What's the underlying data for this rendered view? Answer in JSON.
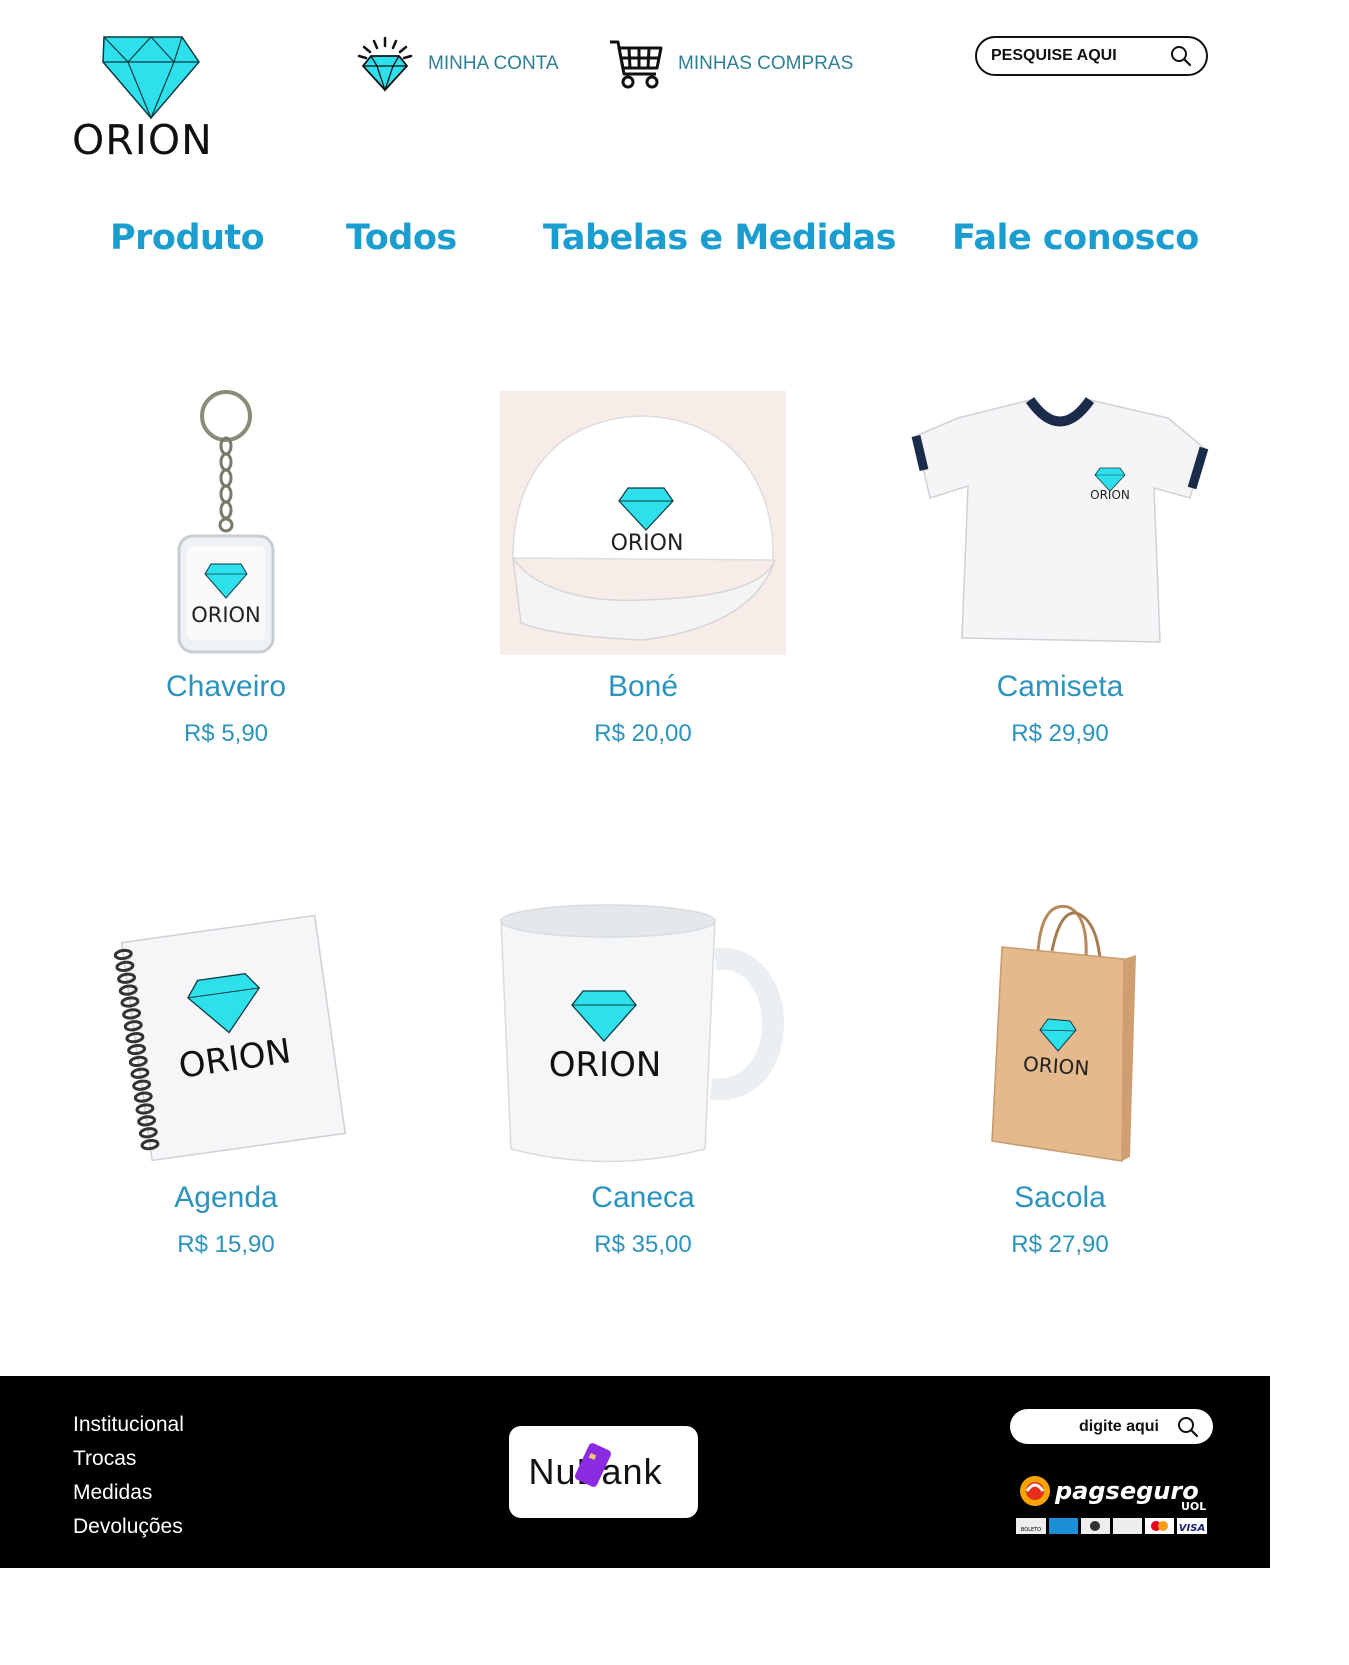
{
  "brand": {
    "name": "ORION"
  },
  "header": {
    "account_label": "MINHA CONTA",
    "purchases_label": "MINHAS COMPRAS",
    "search_label": "PESQUISE AQUI"
  },
  "nav": [
    "Produto",
    "Todos",
    "Tabelas e Medidas",
    "Fale conosco"
  ],
  "products": [
    {
      "name": "Chaveiro",
      "price": "R$ 5,90"
    },
    {
      "name": "Boné",
      "price": "R$ 20,00"
    },
    {
      "name": "Camiseta",
      "price": "R$ 29,90"
    },
    {
      "name": "Agenda",
      "price": "R$ 15,90"
    },
    {
      "name": "Caneca",
      "price": "R$ 35,00"
    },
    {
      "name": "Sacola",
      "price": "R$ 27,90"
    }
  ],
  "footer": {
    "links": [
      "Institucional",
      "Trocas",
      "Medidas",
      "Devoluções"
    ],
    "bank_label": "NuBank",
    "search_label": "digite aqui",
    "payment_brand": "pagseguro",
    "payment_sub": "UOL",
    "payment_methods": [
      "BOLETO",
      "VISA"
    ]
  },
  "colors": {
    "accent": "#1b9dd0",
    "diamond": "#2ee0ec",
    "product_text": "#2b93bd"
  }
}
